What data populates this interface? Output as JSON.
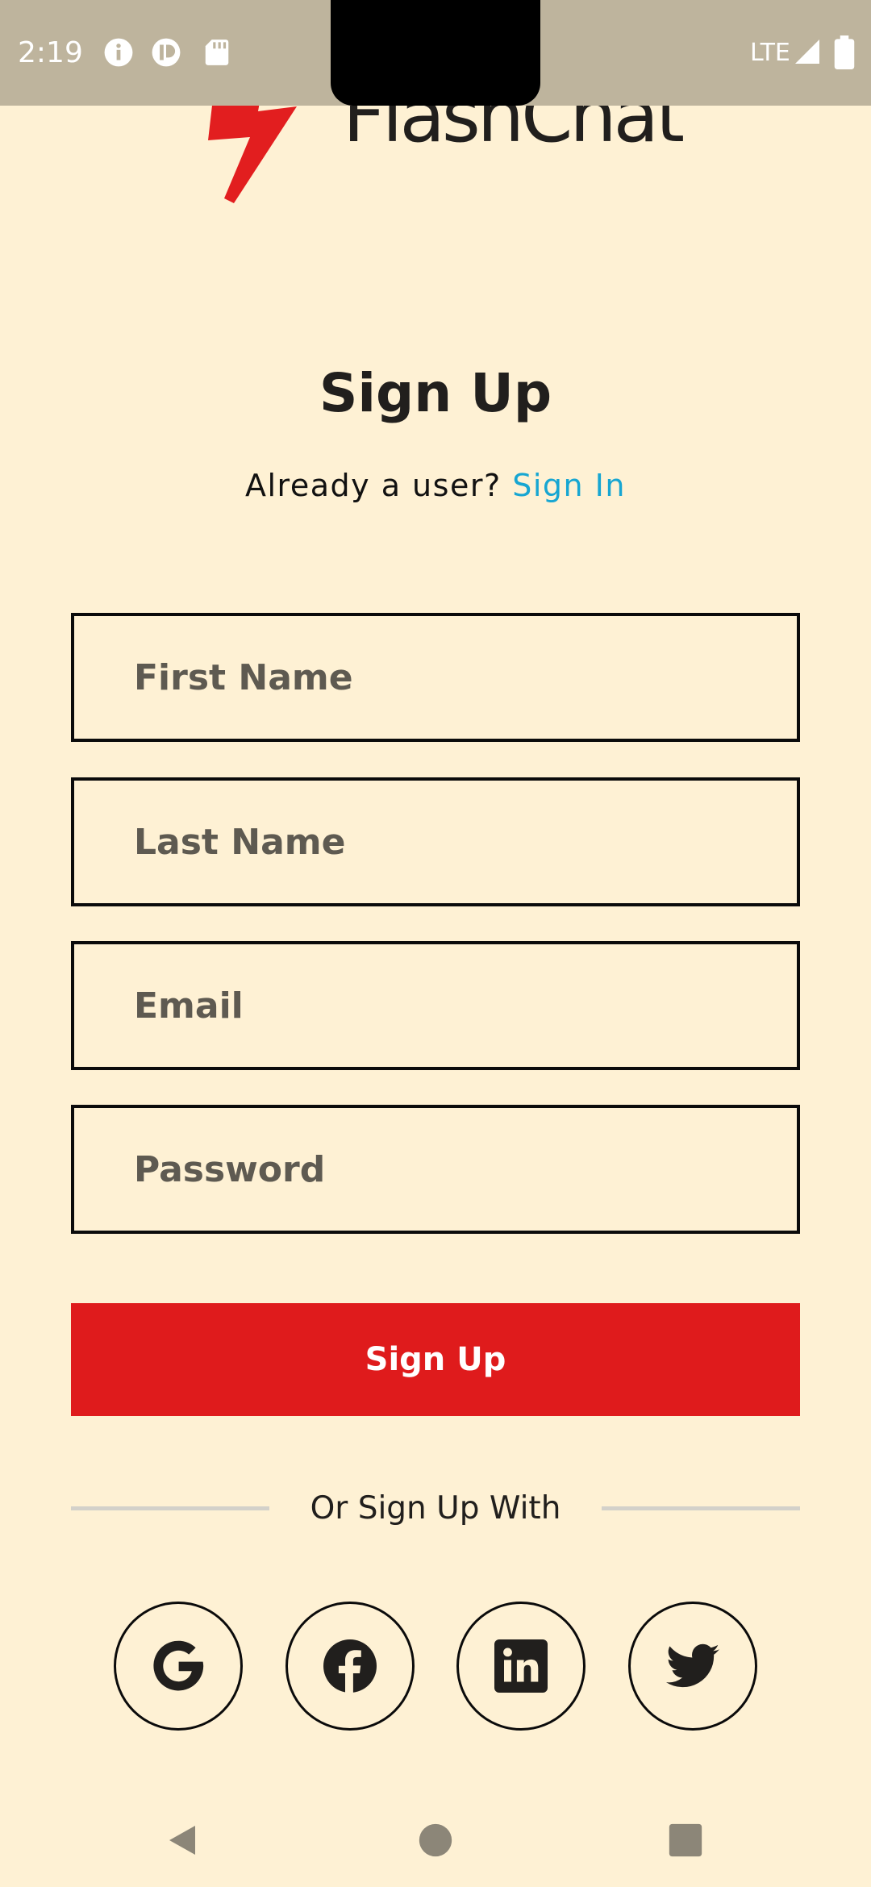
{
  "status_bar": {
    "time": "2:19",
    "network": "LTE",
    "icons": [
      "info-icon",
      "notification-app-icon",
      "sd-card-icon",
      "signal-icon",
      "battery-icon"
    ]
  },
  "app": {
    "brand": "FlashChat",
    "logo_icon": "lightning-bolt-icon"
  },
  "header": {
    "title": "Sign Up",
    "already_user": "Already a user?",
    "sign_in_link": "Sign In"
  },
  "form": {
    "first_name_placeholder": "First Name",
    "last_name_placeholder": "Last Name",
    "email_placeholder": "Email",
    "password_placeholder": "Password",
    "submit_label": "Sign Up"
  },
  "social": {
    "divider_text": "Or Sign Up With",
    "providers": [
      {
        "name": "Google",
        "icon": "google-icon"
      },
      {
        "name": "Facebook",
        "icon": "facebook-icon"
      },
      {
        "name": "LinkedIn",
        "icon": "linkedin-icon"
      },
      {
        "name": "Twitter",
        "icon": "twitter-icon"
      }
    ]
  },
  "nav": {
    "icons": [
      "back-icon",
      "home-icon",
      "recents-icon"
    ]
  },
  "colors": {
    "background": "#fef1d4",
    "status_bar": "#beb49d",
    "primary": "#df1b1c",
    "link": "#17a6d2",
    "text": "#211f1d",
    "placeholder": "#5e5a51"
  }
}
